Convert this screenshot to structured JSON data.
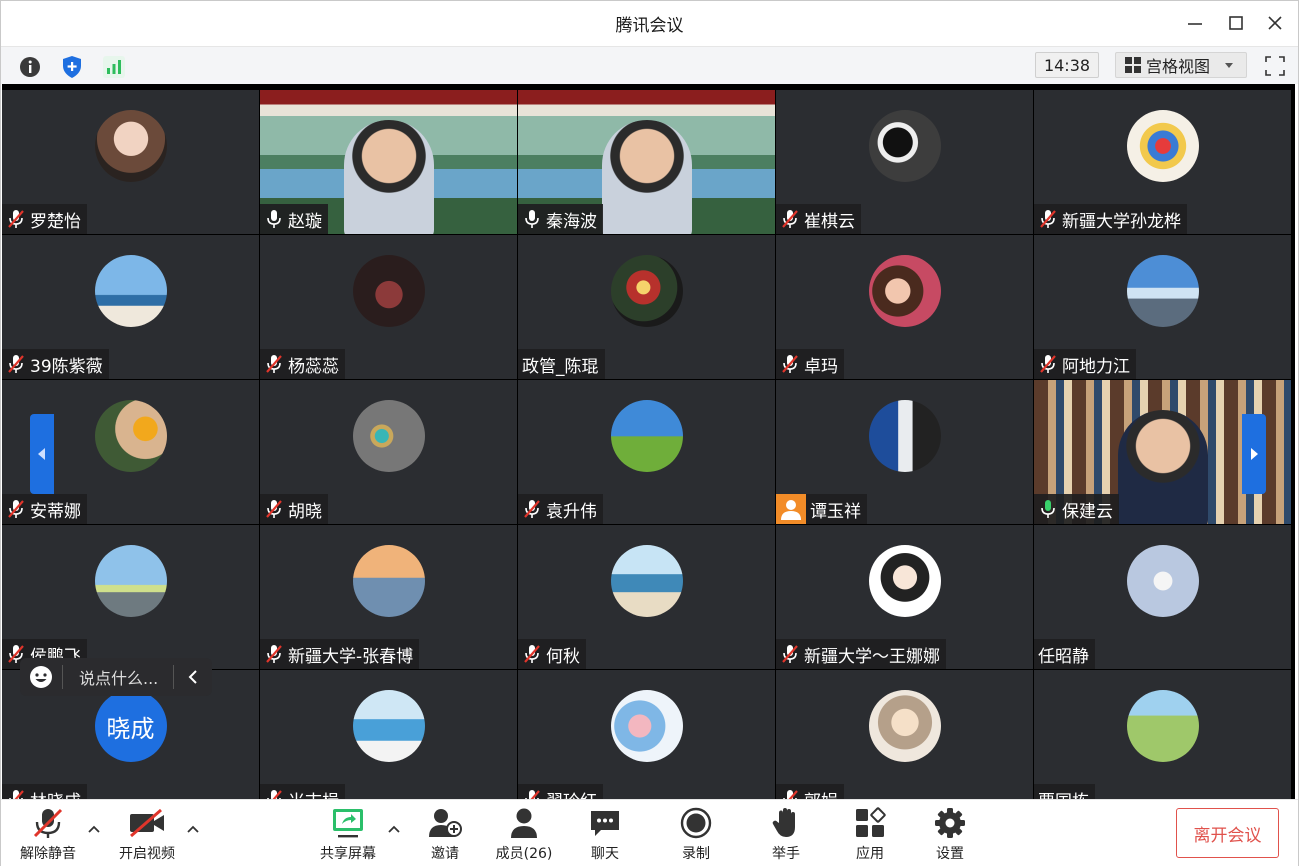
{
  "window": {
    "title": "腾讯会议"
  },
  "infobar": {
    "time": "14:38",
    "view_label": "宫格视图"
  },
  "participants": [
    {
      "name": "罗楚怡",
      "mic": "muted"
    },
    {
      "name": "赵璇",
      "mic": "on"
    },
    {
      "name": "秦海波",
      "mic": "on"
    },
    {
      "name": "崔棋云",
      "mic": "muted"
    },
    {
      "name": "新疆大学孙龙桦",
      "mic": "muted"
    },
    {
      "name": "39陈紫薇",
      "mic": "muted"
    },
    {
      "name": "杨蕊蕊",
      "mic": "muted"
    },
    {
      "name": "政管_陈琨",
      "mic": "none"
    },
    {
      "name": "卓玛",
      "mic": "muted"
    },
    {
      "name": "阿地力江",
      "mic": "muted"
    },
    {
      "name": "安蒂娜",
      "mic": "muted"
    },
    {
      "name": "胡晓",
      "mic": "muted"
    },
    {
      "name": "袁升伟",
      "mic": "muted"
    },
    {
      "name": "谭玉祥",
      "mic": "user"
    },
    {
      "name": "保建云",
      "mic": "active"
    },
    {
      "name": "侯鹏飞",
      "mic": "muted"
    },
    {
      "name": "新疆大学-张春博",
      "mic": "muted"
    },
    {
      "name": "何秋",
      "mic": "muted"
    },
    {
      "name": "新疆大学～王娜娜",
      "mic": "muted"
    },
    {
      "name": "任昭静",
      "mic": "none"
    },
    {
      "name": "林晓成",
      "mic": "muted",
      "avatar_text": "晓成"
    },
    {
      "name": "米志楫",
      "mic": "muted"
    },
    {
      "name": "翟玲红",
      "mic": "muted"
    },
    {
      "name": "郭娟",
      "mic": "muted"
    },
    {
      "name": "贾国栋",
      "mic": "none"
    }
  ],
  "chat": {
    "placeholder": "说点什么..."
  },
  "toolbar": {
    "unmute": "解除静音",
    "start_video": "开启视频",
    "share_screen": "共享屏幕",
    "invite": "邀请",
    "members": "成员(26)",
    "chat": "聊天",
    "record": "录制",
    "raise_hand": "举手",
    "apps": "应用",
    "settings": "设置",
    "leave": "离开会议"
  }
}
